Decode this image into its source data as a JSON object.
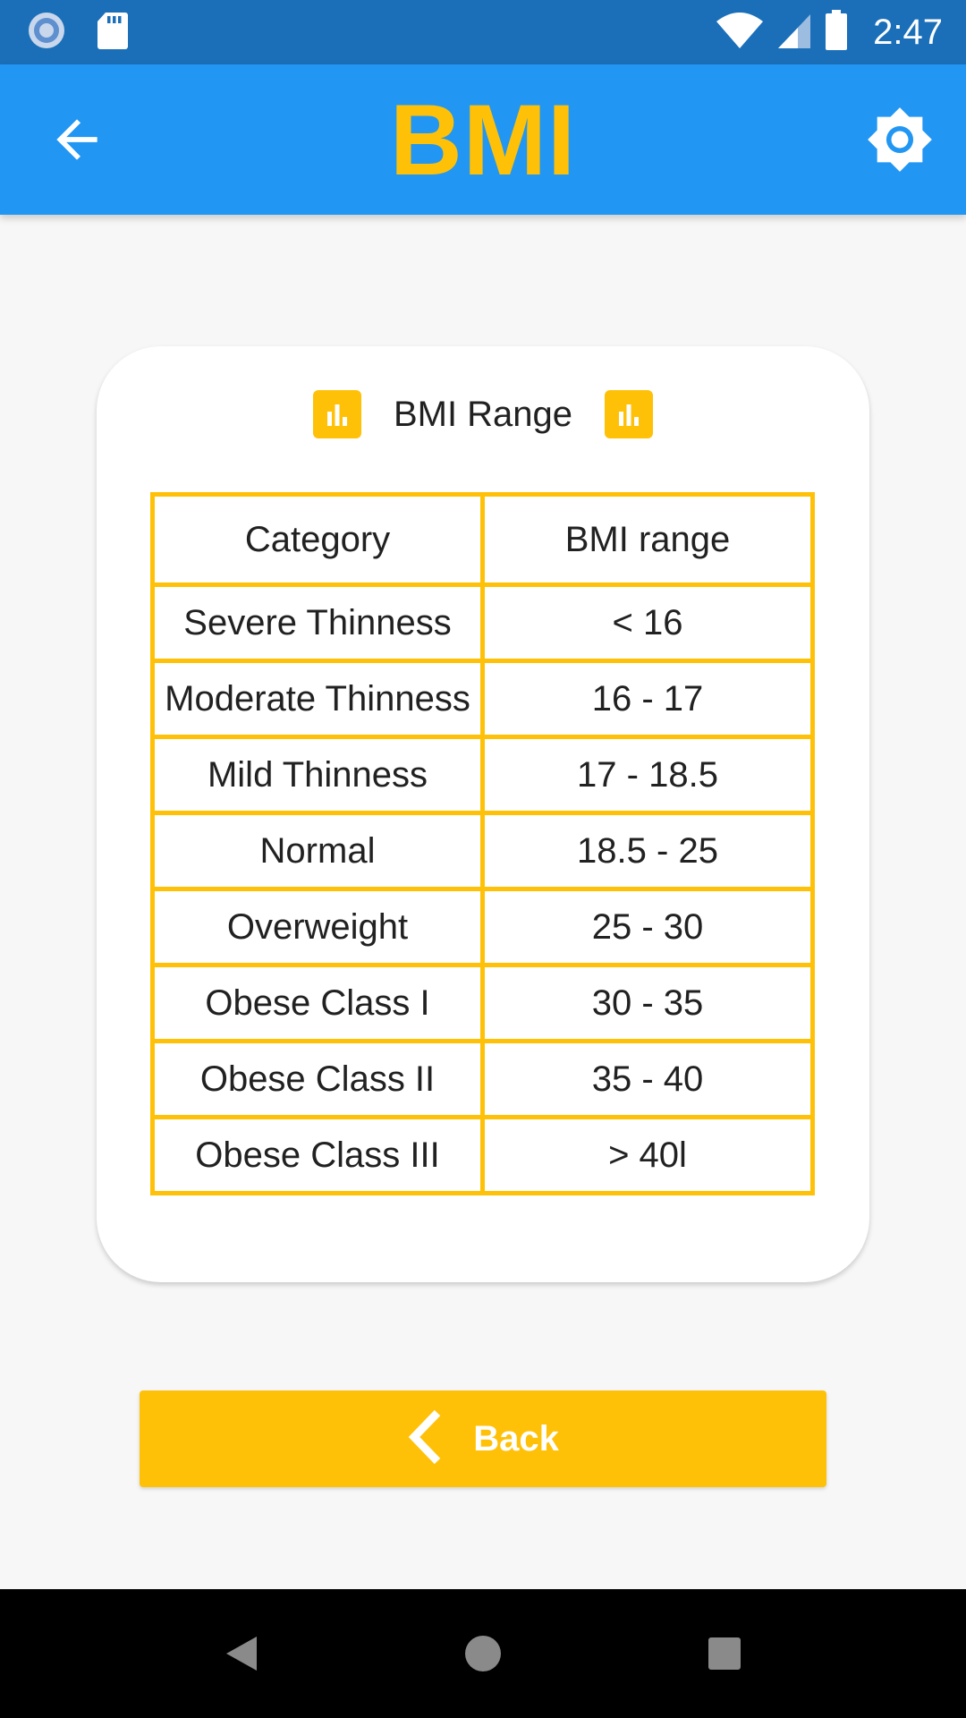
{
  "status_bar": {
    "time": "2:47",
    "icons": [
      "sync-icon",
      "sd-card-icon",
      "wifi-icon",
      "cell-signal-icon",
      "battery-icon"
    ]
  },
  "app_bar": {
    "title": "BMI",
    "back_icon": "arrow-back-icon",
    "settings_icon": "brightness-icon"
  },
  "card": {
    "title": "BMI Range",
    "header_icon": "bar-chart-icon"
  },
  "table": {
    "headers": [
      "Category",
      "BMI range"
    ],
    "rows": [
      [
        "Severe Thinness",
        "< 16"
      ],
      [
        "Moderate Thinness",
        "16 - 17"
      ],
      [
        "Mild Thinness",
        "17 - 18.5"
      ],
      [
        "Normal",
        "18.5 - 25"
      ],
      [
        "Overweight",
        "25 - 30"
      ],
      [
        "Obese Class I",
        "30 - 35"
      ],
      [
        "Obese Class II",
        "35 - 40"
      ],
      [
        "Obese Class III",
        "> 40l"
      ]
    ]
  },
  "back_button": {
    "label": "Back",
    "icon": "chevron-left-icon"
  },
  "nav_bar": {
    "icons": [
      "nav-back-icon",
      "nav-home-icon",
      "nav-recents-icon"
    ]
  },
  "colors": {
    "status_bar": "#1B6FB8",
    "app_bar": "#2196F3",
    "accent": "#FFC107",
    "background": "#F7F7F7"
  }
}
